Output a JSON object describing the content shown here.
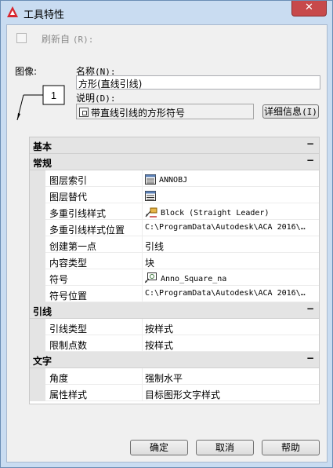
{
  "window": {
    "title": "工具特性",
    "close_label": "✕"
  },
  "refresh": {
    "label": "刷新自",
    "hotkey": "(R):",
    "checked": false
  },
  "image_label": "图像:",
  "preview": {
    "balloon_text": "1"
  },
  "name": {
    "label": "名称",
    "hotkey": "(N):",
    "value": "方形(直线引线)"
  },
  "description": {
    "label": "说明",
    "hotkey": "(D):",
    "value": "带直线引线的方形符号",
    "details_button": "详细信息",
    "details_hotkey": "(I)"
  },
  "sections": {
    "basic": {
      "title": "基本",
      "toggle": "−"
    },
    "general": {
      "title": "常规",
      "toggle": "−",
      "rows": [
        {
          "key": "图层索引",
          "value": "ANNOBJ",
          "icon": "layer-key-icon"
        },
        {
          "key": "图层替代",
          "value": "",
          "icon": "layer-override-icon"
        },
        {
          "key": "多重引线样式",
          "value": "Block (Straight Leader)",
          "icon": "mleader-style-icon"
        },
        {
          "key": "多重引线样式位置",
          "value": "C:\\ProgramData\\Autodesk\\ACA  2016\\…"
        },
        {
          "key": "创建第一点",
          "value": "引线"
        },
        {
          "key": "内容类型",
          "value": "块"
        },
        {
          "key": "符号",
          "value": "Anno_Square_na",
          "icon": "symbol-icon"
        },
        {
          "key": "符号位置",
          "value": "C:\\ProgramData\\Autodesk\\ACA  2016\\…"
        }
      ]
    },
    "leader": {
      "title": "引线",
      "toggle": "−",
      "rows": [
        {
          "key": "引线类型",
          "value": "按样式"
        },
        {
          "key": "限制点数",
          "value": "按样式"
        }
      ]
    },
    "text": {
      "title": "文字",
      "toggle": "−",
      "rows": [
        {
          "key": "角度",
          "value": "强制水平"
        },
        {
          "key": "属性样式",
          "value": "目标图形文字样式"
        }
      ]
    }
  },
  "buttons": {
    "ok": "确定",
    "cancel": "取消",
    "help": "帮助"
  },
  "colors": {
    "title_bar": "#c9dcf1",
    "close_button": "#c7494b",
    "section_header": "#e4e4e4"
  }
}
